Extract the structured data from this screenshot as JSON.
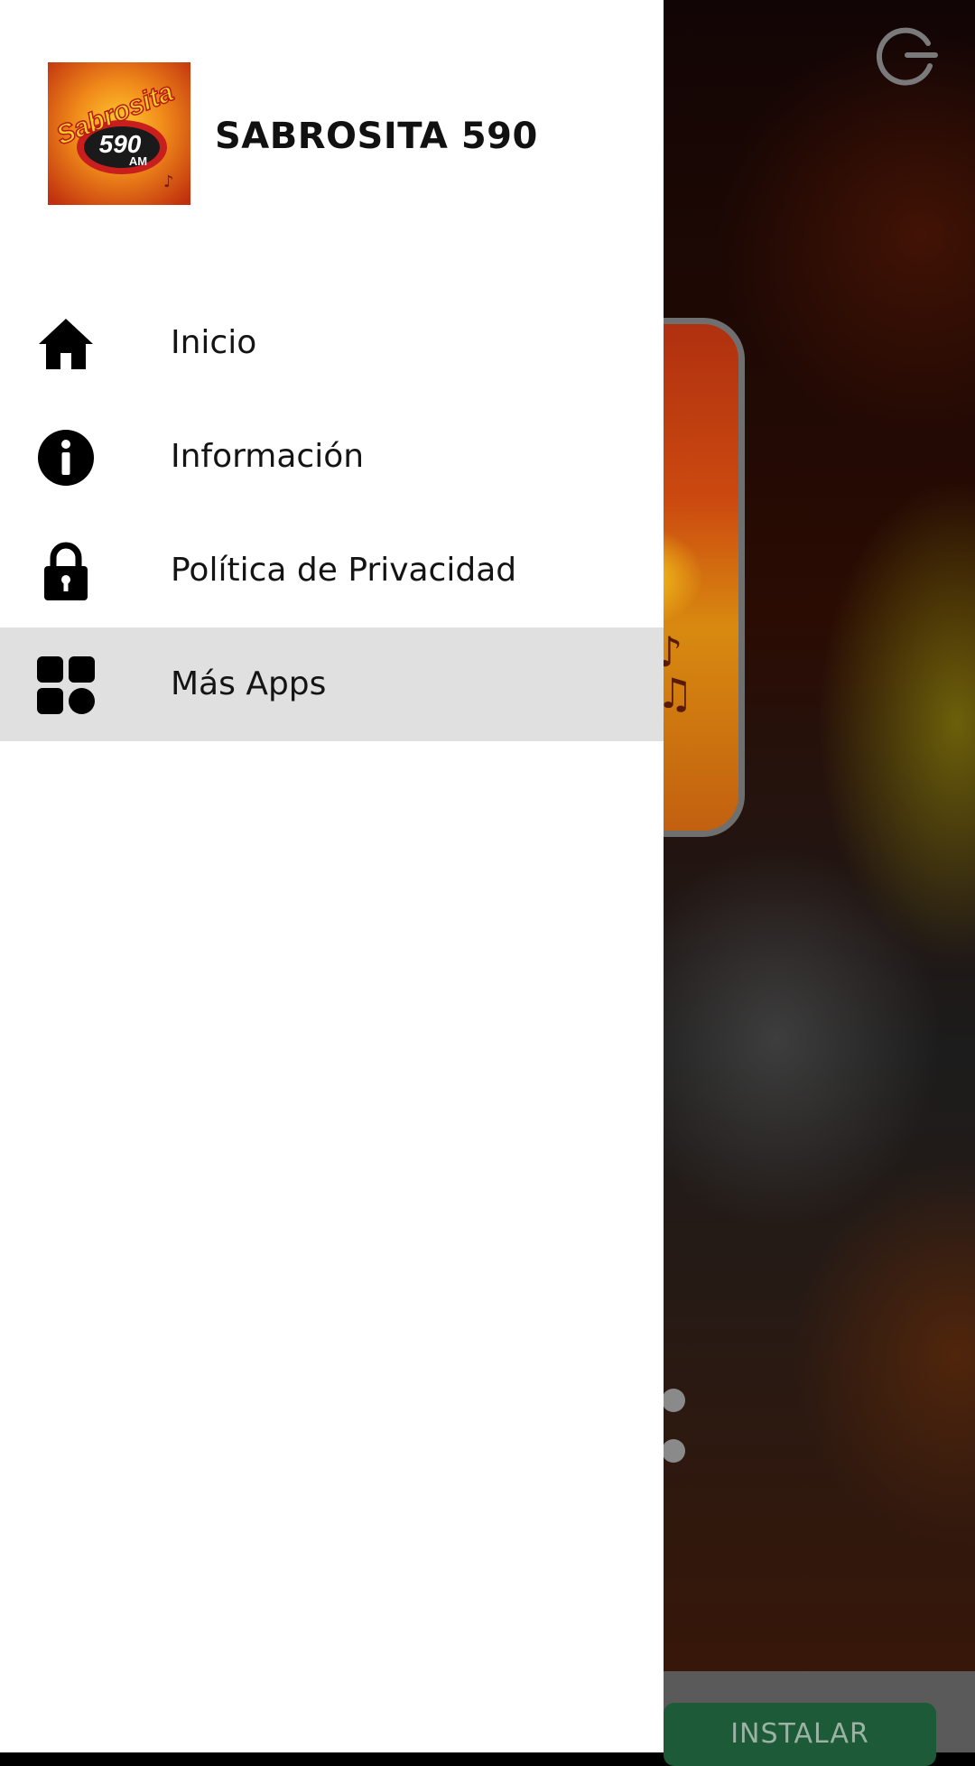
{
  "app": {
    "title": "SABROSITA 590",
    "logo": {
      "text_line1": "Sabrosita",
      "text_line2": "590",
      "text_line3": "AM",
      "colors": {
        "orange": "#e8761a",
        "yellow": "#f5c518",
        "red": "#c81e1e",
        "black": "#1a1a1a"
      }
    }
  },
  "menu": {
    "items": [
      {
        "label": "Inicio",
        "icon": "home-icon",
        "selected": false
      },
      {
        "label": "Información",
        "icon": "info-icon",
        "selected": false
      },
      {
        "label": "Política de Privacidad",
        "icon": "lock-icon",
        "selected": false
      },
      {
        "label": "Más Apps",
        "icon": "apps-grid-icon",
        "selected": true
      }
    ]
  },
  "background": {
    "power_icon": "power-icon",
    "install_label": "INSTALAR",
    "selected_color": "#e0e0e0",
    "install_color": "#1d5a38"
  }
}
